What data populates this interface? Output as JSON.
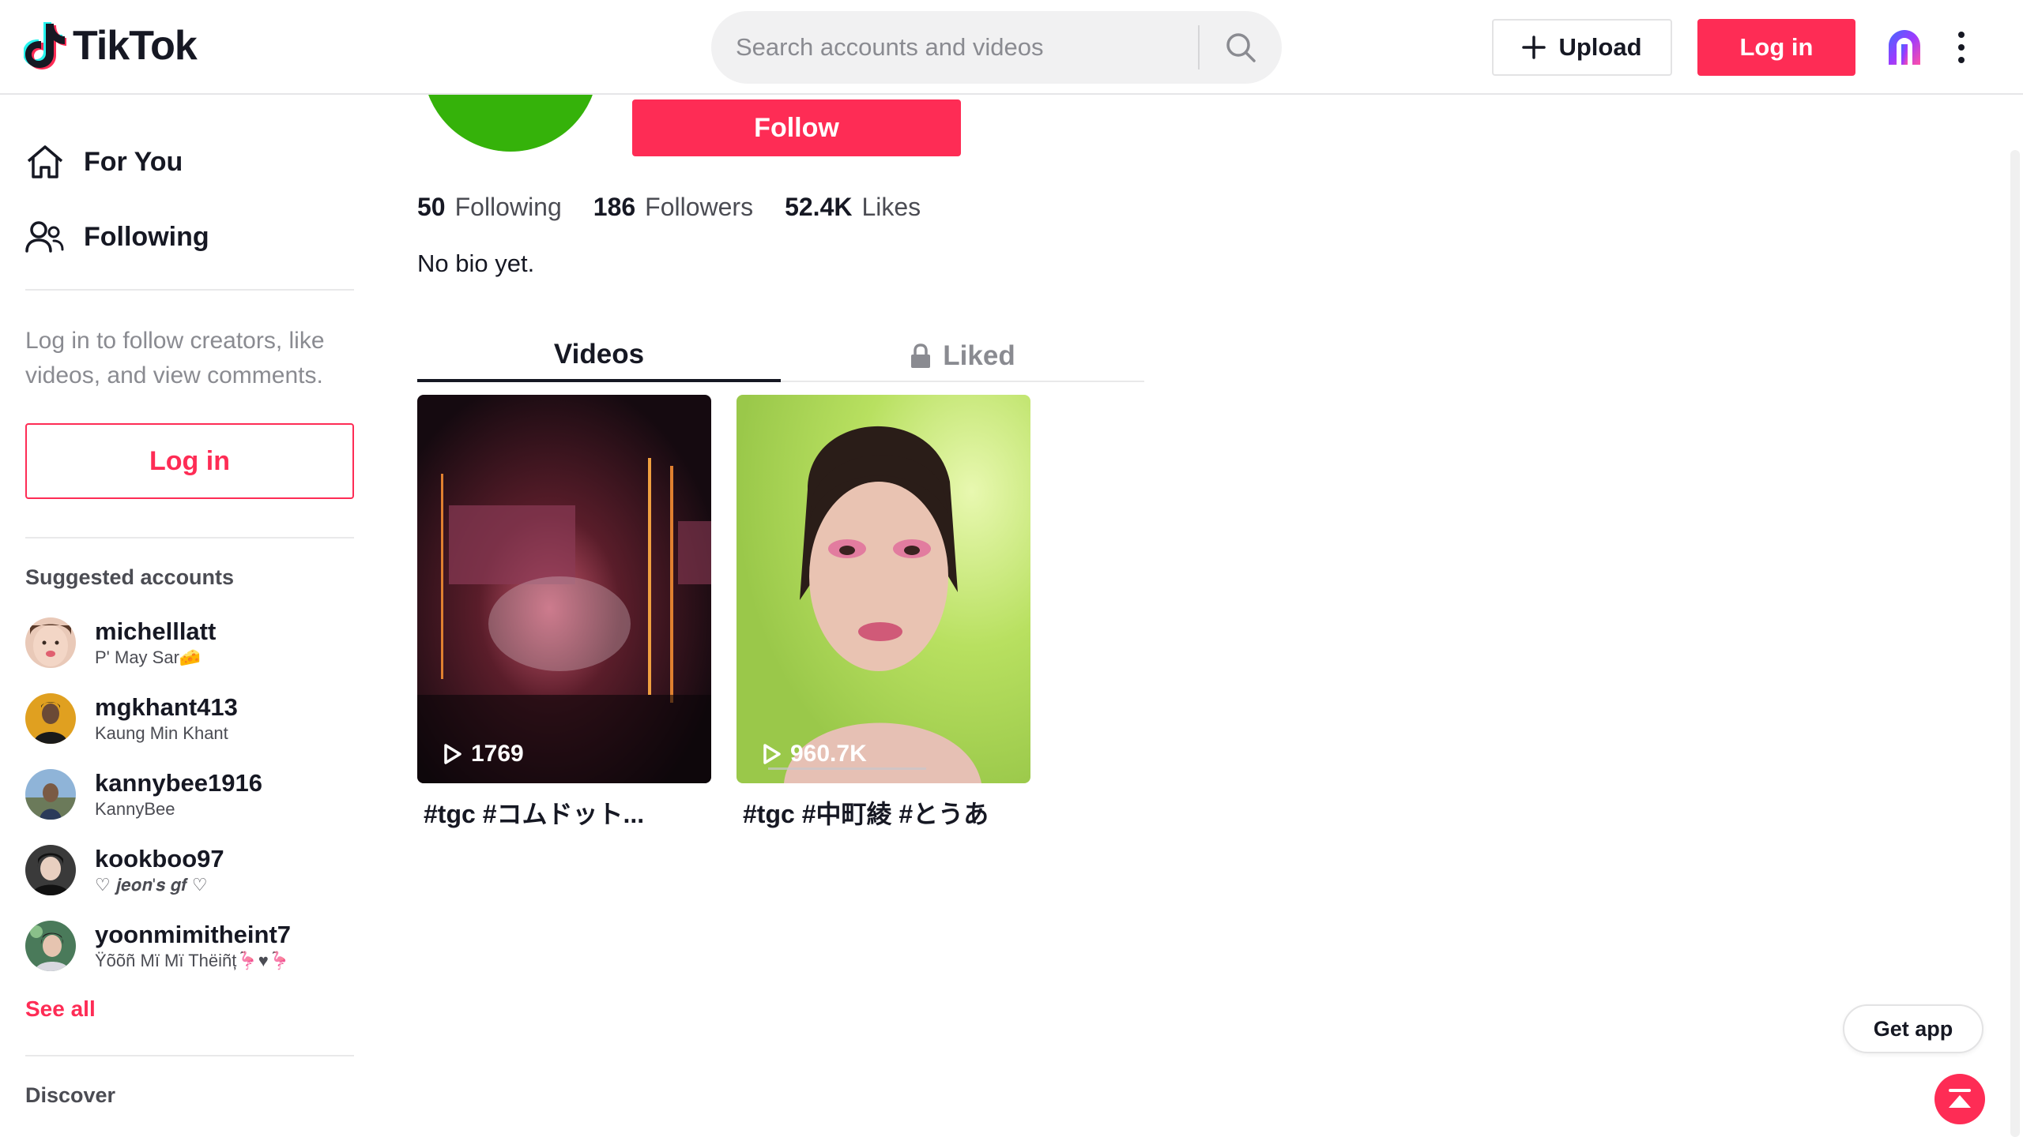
{
  "header": {
    "logo_text": "TikTok",
    "search_placeholder": "Search accounts and videos",
    "upload_label": "Upload",
    "login_label": "Log in",
    "accent_color": "#fe2c55"
  },
  "sidebar": {
    "nav": [
      {
        "label": "For You",
        "icon": "home-icon"
      },
      {
        "label": "Following",
        "icon": "users-icon"
      }
    ],
    "login_hint": "Log in to follow creators, like videos, and view comments.",
    "login_button": "Log in",
    "suggested_title": "Suggested accounts",
    "accounts": [
      {
        "username": "michelllatt",
        "display": "P' May Sar🧀"
      },
      {
        "username": "mgkhant413",
        "display": "Kaung Min Khant"
      },
      {
        "username": "kannybee1916",
        "display": "KannyBee"
      },
      {
        "username": "kookboo97",
        "display": "♡ 𝒋𝒆𝒐𝒏'𝒔 𝒈𝒇 ♡"
      },
      {
        "username": "yoonmimitheint7",
        "display": "Ÿõõñ Mï Mï Thëiñț🦩♥🦩"
      }
    ],
    "see_all": "See all",
    "discover_title": "Discover"
  },
  "profile": {
    "follow_button": "Follow",
    "stats": [
      {
        "value": "50",
        "label": "Following"
      },
      {
        "value": "186",
        "label": "Followers"
      },
      {
        "value": "52.4K",
        "label": "Likes"
      }
    ],
    "bio": "No bio yet.",
    "tabs": {
      "videos": "Videos",
      "liked": "Liked"
    },
    "videos": [
      {
        "views": "1769",
        "caption": "#tgc #コムドット..."
      },
      {
        "views": "960.7K",
        "caption": "#tgc #中町綾 #とうあ"
      }
    ]
  },
  "floating": {
    "get_app": "Get app"
  }
}
